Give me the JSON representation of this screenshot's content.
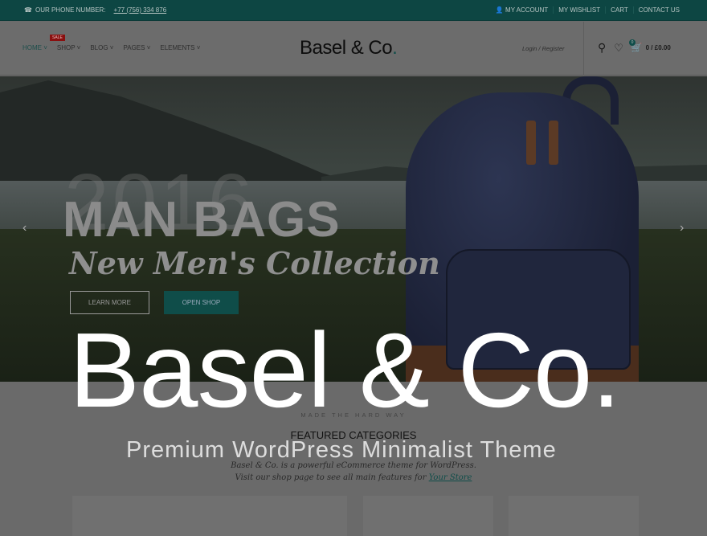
{
  "topbar": {
    "phone_label": "OUR PHONE NUMBER:",
    "phone": "+77 (756) 334 876",
    "links": [
      "MY ACCOUNT",
      "MY WISHLIST",
      "CART",
      "CONTACT US"
    ]
  },
  "header": {
    "nav": [
      "HOME",
      "SHOP",
      "BLOG",
      "PAGES",
      "ELEMENTS"
    ],
    "sale_badge": "SALE",
    "logo": "Basel & Co",
    "logo_dot": ".",
    "login": "Login / Register",
    "wishlist_count": "0",
    "cart": "0 / £0.00"
  },
  "hero": {
    "year": "2016",
    "title": "MAN BAGS",
    "subtitle": "New Men's Collection",
    "learn_more": "LEARN MORE",
    "open_shop": "OPEN SHOP"
  },
  "overlay": {
    "title": "Basel & Co.",
    "subtitle": "Premium WordPress Minimalist Theme"
  },
  "featured": {
    "eyebrow": "MADE THE HARD WAY",
    "title": "FEATURED CATEGORIES",
    "line1": "Basel & Co. is a powerful eCommerce theme for WordPress.",
    "line2": "Visit our shop page to see all main features for",
    "link": "Your Store"
  },
  "colors": {
    "accent": "#0f4d49",
    "sale": "#8a1010"
  }
}
